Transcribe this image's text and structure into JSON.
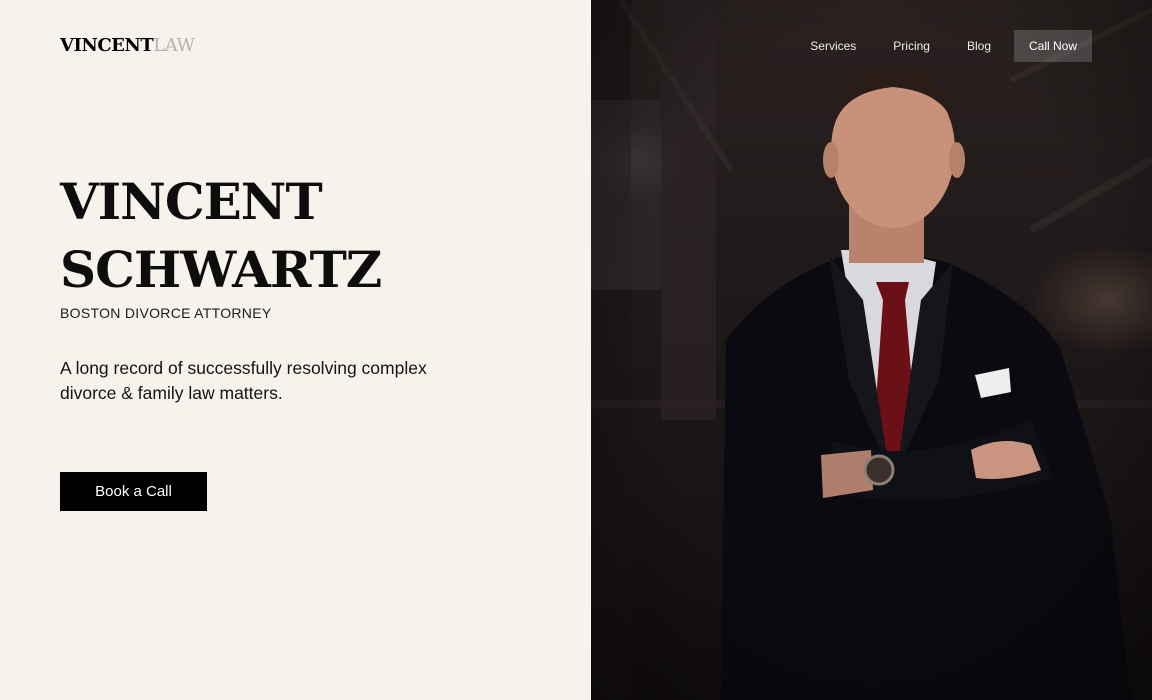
{
  "logo": {
    "part1": "VINCENT",
    "part2": "LAW"
  },
  "nav": {
    "items": [
      "Services",
      "Pricing",
      "Blog"
    ],
    "cta": "Call Now"
  },
  "hero": {
    "title_line1": "VINCENT",
    "title_line2": "SCHWARTZ",
    "subtitle": "BOSTON DIVORCE ATTORNEY",
    "description": "A long record of successfully resolving complex divorce & family law matters.",
    "cta": "Book a Call"
  },
  "colors": {
    "background": "#f7f2ec",
    "button": "#000000",
    "photo_dark": "#1c1617"
  },
  "image": {
    "icon": "attorney-portrait"
  }
}
